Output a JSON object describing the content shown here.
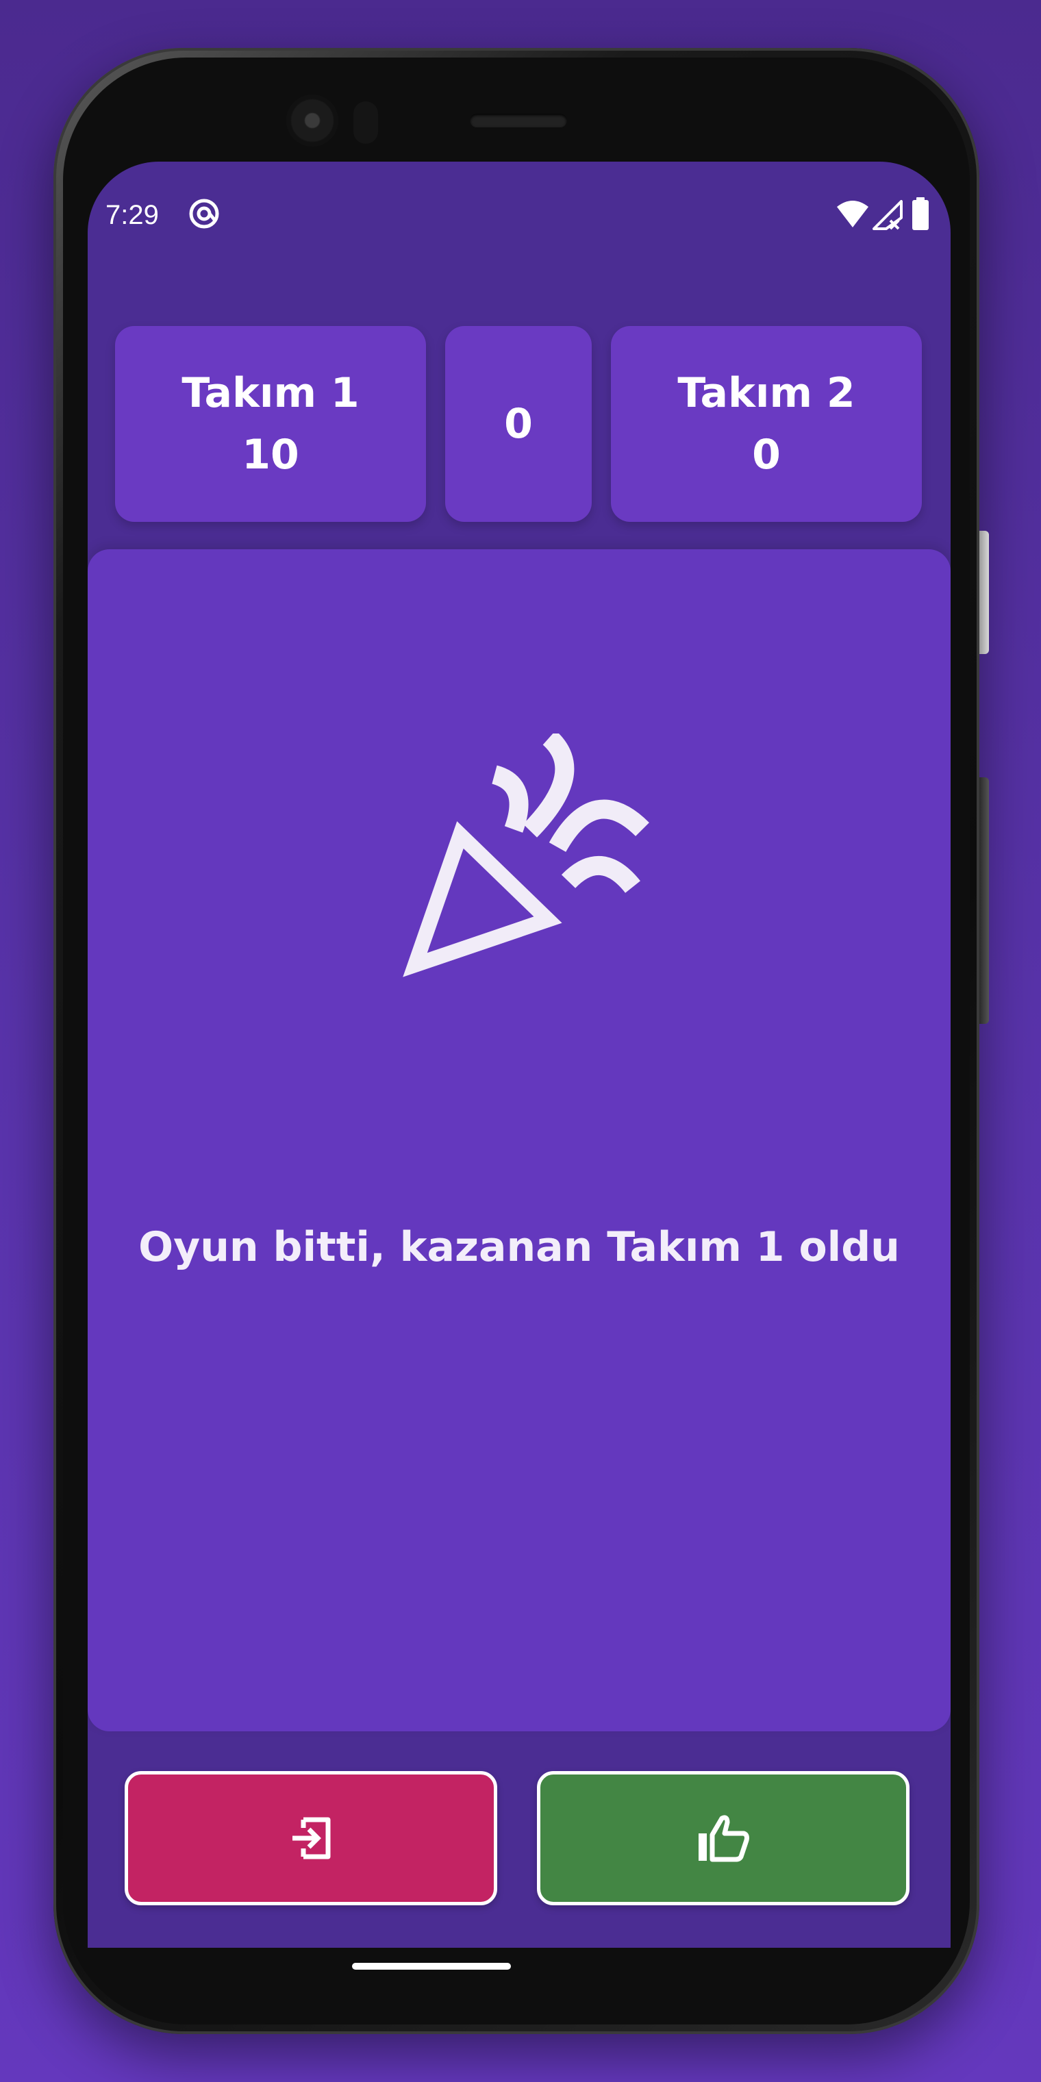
{
  "status_bar": {
    "time": "7:29",
    "icons": [
      "at-sign-icon",
      "wifi-icon",
      "cellular-no-signal-icon",
      "battery-icon"
    ]
  },
  "scoreboard": {
    "team1": {
      "name": "Takım 1",
      "score": "10"
    },
    "round": {
      "value": "0"
    },
    "team2": {
      "name": "Takım 2",
      "score": "0"
    }
  },
  "result": {
    "icon": "celebration-icon",
    "message": "Oyun bitti, kazanan Takım 1 oldu"
  },
  "buttons": {
    "exit": {
      "icon": "exit-icon",
      "color": "#c32363"
    },
    "like": {
      "icon": "thumb-up-icon",
      "color": "#438644"
    }
  },
  "colors": {
    "background": "#5a34ad",
    "screen": "#4b2d93",
    "card": "#6a3ac2",
    "main_card": "#6438be"
  }
}
